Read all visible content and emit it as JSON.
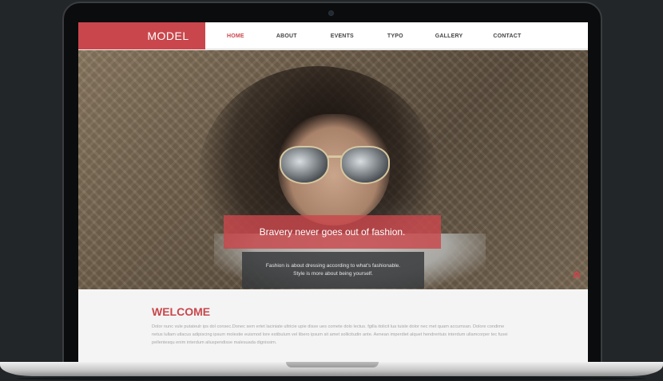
{
  "site": {
    "logo": "MODEL",
    "nav": [
      "HOME",
      "ABOUT",
      "EVENTS",
      "TYPO",
      "GALLERY",
      "CONTACT"
    ],
    "active_nav": "HOME"
  },
  "hero": {
    "headline": "Bravery never goes out of fashion.",
    "line1": "Fashion is about dressing according to what's fashionable.",
    "line2": "Style is more about being yourself."
  },
  "welcome": {
    "title": "WELCOME",
    "text": "Dolor nunc vule putateulr ips dol consec.Donec sem ertet laciniate ultricie upie disse ues comete dolo lectus. fgilla itolicit lua tuisle dolor nec met quam accumsan. Dolore condime netus lullam utlacus adipiscing ipsum molestie euismod lore estibulum vel libero ipsum sit amet sollicitudin ante. Aenean imperdiet alquet hendrerituis interdum ullamcorper tec fusei pellentesqu enim interdum aliuspendisse malesuada dignissim."
  },
  "colors": {
    "accent": "#c9474c",
    "background": "#222629"
  },
  "icons": {
    "scroll_up": "double-chevron-up-icon",
    "camera": "webcam-icon"
  }
}
